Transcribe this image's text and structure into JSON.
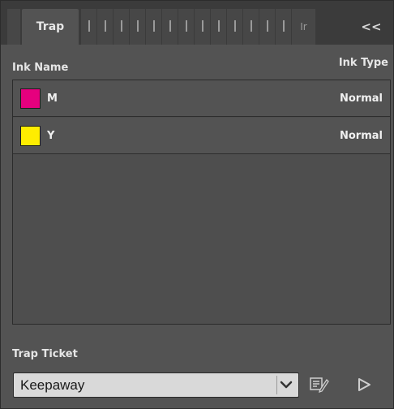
{
  "tabs": {
    "active_label": "Trap",
    "collapsed_glyphs": [
      "",
      "",
      "",
      "",
      "",
      "",
      "",
      "",
      "",
      "",
      "",
      "",
      "",
      "Ir"
    ],
    "collapse_symbol": "<<"
  },
  "list_header": {
    "ink_name_label": "Ink Name",
    "ink_type_label": "Ink Type"
  },
  "inks": [
    {
      "name": "M",
      "type": "Normal",
      "swatch_color": "#e6007e",
      "swatch_icon": "magenta-swatch-icon"
    },
    {
      "name": "Y",
      "type": "Normal",
      "swatch_color": "#ffed00",
      "swatch_icon": "yellow-swatch-icon"
    }
  ],
  "trap_ticket": {
    "label": "Trap Ticket",
    "selected_value": "Keepaway",
    "dropdown_icon": "chevron-down-icon",
    "edit_icon": "edit-ticket-icon",
    "apply_icon": "play-icon"
  },
  "colors": {
    "panel_bg": "#535353",
    "tabbar_bg": "#3b3b3b",
    "text": "#e6e6e6"
  }
}
